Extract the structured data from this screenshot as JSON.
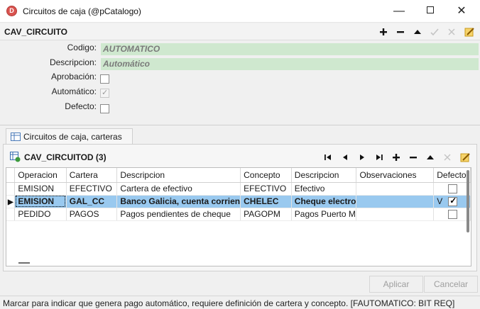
{
  "window": {
    "title": "Circuitos de caja (@pCatalogo)",
    "app_icon_letter": "D",
    "minimize_glyph": "—",
    "close_glyph": "✕"
  },
  "header": {
    "section_title": "CAV_CIRCUITO",
    "icons": [
      "plus-icon",
      "minus-icon",
      "arrow-up-icon",
      "check-icon",
      "cancel-icon",
      "edit-note-icon"
    ]
  },
  "form": {
    "fields": [
      {
        "label": "Codigo:",
        "value": "AUTOMATICO"
      },
      {
        "label": "Descripcion:",
        "value": "Automático"
      }
    ],
    "checkboxes": [
      {
        "label": "Aprobación:",
        "checked": false,
        "disabled": false
      },
      {
        "label": "Automático:",
        "checked": true,
        "disabled": true
      },
      {
        "label": "Defecto:",
        "checked": false,
        "disabled": false
      }
    ]
  },
  "tabs": [
    {
      "label": "Circuitos de caja, carteras",
      "active": true
    }
  ],
  "grid": {
    "title": "CAV_CIRCUITOD (3)",
    "icons": [
      "first-icon",
      "prev-icon",
      "next-icon",
      "last-icon",
      "plus-icon",
      "minus-icon",
      "arrow-up-icon",
      "cancel-icon",
      "edit-note-icon"
    ],
    "columns": [
      "Operacion",
      "Cartera",
      "Descripcion",
      "Concepto",
      "Descripcion",
      "Observaciones",
      "Defecto"
    ],
    "rows": [
      {
        "operacion": "EMISION",
        "cartera": "EFECTIVO",
        "descripcion": "Cartera de efectivo",
        "concepto": "EFECTIVO",
        "descripcion2": "Efectivo",
        "observaciones": "",
        "defecto_text": "",
        "defecto_checked": false,
        "selected": false
      },
      {
        "operacion": "EMISION",
        "cartera": "GAL_CC",
        "descripcion": "Banco Galicia, cuenta corrien",
        "concepto": "CHELEC",
        "descripcion2": "Cheque electro",
        "observaciones": "",
        "defecto_text": "V",
        "defecto_checked": true,
        "selected": true
      },
      {
        "operacion": "PEDIDO",
        "cartera": "PAGOS",
        "descripcion": "Pagos pendientes de cheque",
        "concepto": "PAGOPM",
        "descripcion2": "Pagos Puerto M",
        "observaciones": "",
        "defecto_text": "",
        "defecto_checked": false,
        "selected": false
      }
    ]
  },
  "buttons": {
    "apply": "Aplicar",
    "cancel": "Cancelar"
  },
  "status": {
    "text": "Marcar para indicar que genera pago automático, requiere definición de cartera y concepto. [FAUTOMATICO: BIT REQ]"
  }
}
